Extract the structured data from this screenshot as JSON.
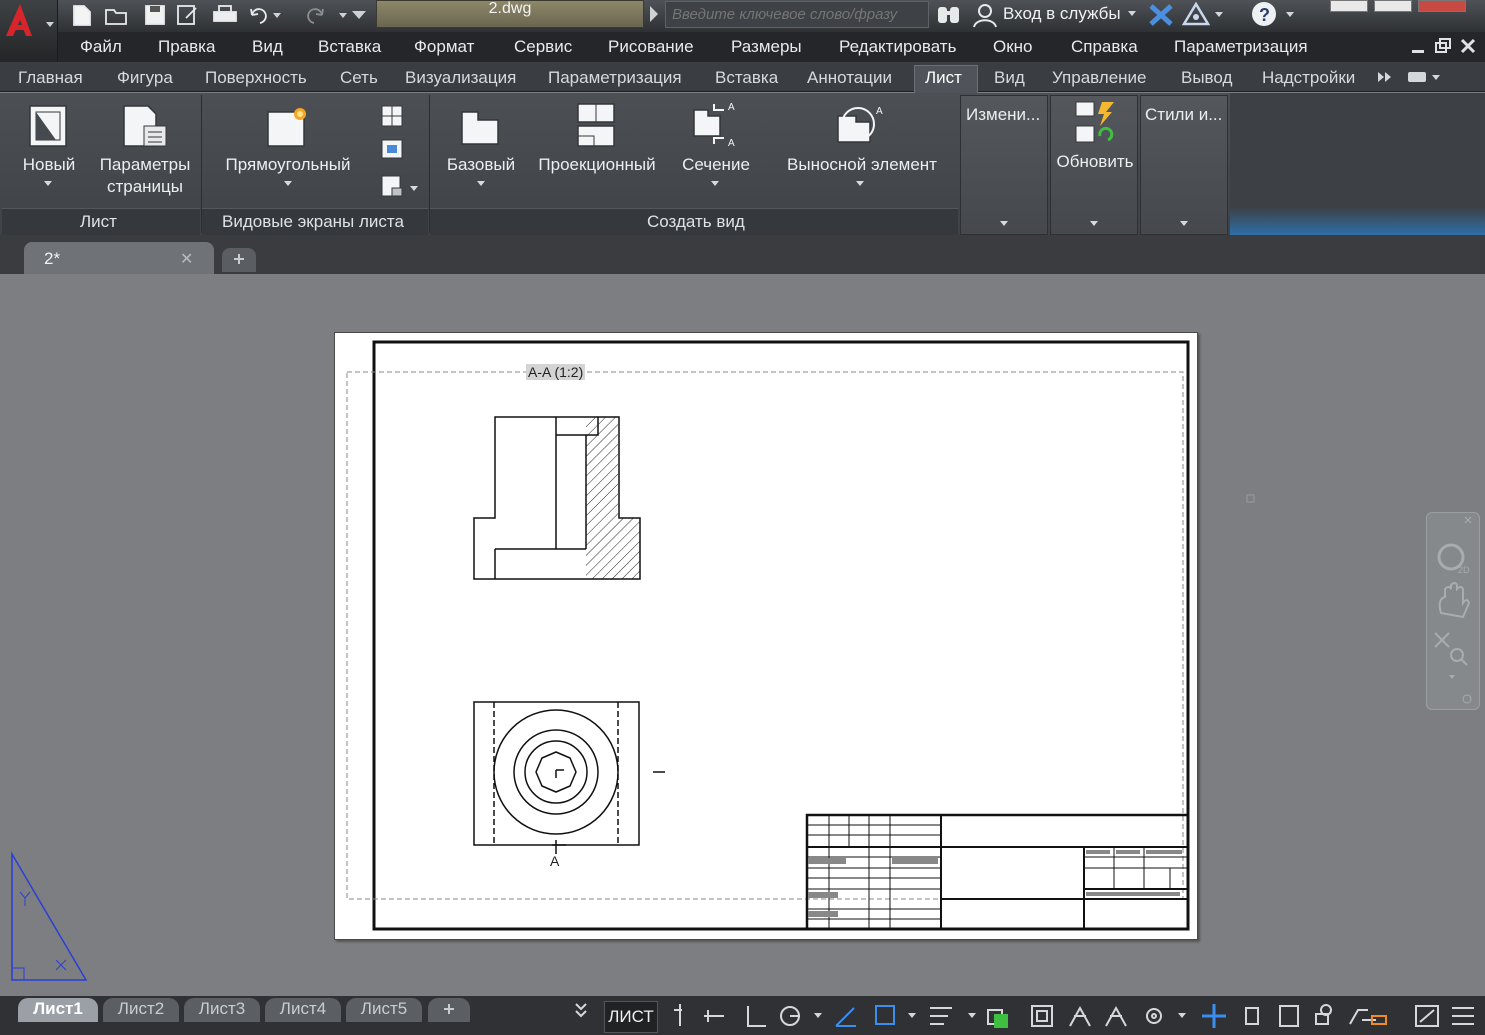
{
  "window": {
    "document_title": "2.dwg",
    "search_placeholder": "Введите ключевое слово/фразу",
    "signin_label": "Вход в службы"
  },
  "menu": [
    "Файл",
    "Правка",
    "Вид",
    "Вставка",
    "Формат",
    "Сервис",
    "Рисование",
    "Размеры",
    "Редактировать",
    "Окно",
    "Справка",
    "Параметризация"
  ],
  "ribbon_tabs": [
    "Главная",
    "Фигура",
    "Поверхность",
    "Сеть",
    "Визуализация",
    "Параметризация",
    "Вставка",
    "Аннотации",
    "Лист",
    "Вид",
    "Управление",
    "Вывод",
    "Надстройки"
  ],
  "active_ribbon_tab": "Лист",
  "ribbon": {
    "panel_sheet": {
      "title": "Лист",
      "new_label": "Новый",
      "page_setup_label": "Параметры страницы"
    },
    "panel_viewports": {
      "title": "Видовые экраны листа",
      "rectangular_label": "Прямоугольный"
    },
    "panel_create_view": {
      "title": "Создать вид",
      "base_label": "Базовый",
      "projected_label": "Проекционный",
      "section_label": "Сечение",
      "detail_label": "Выносной элемент"
    },
    "modify_label": "Измени...",
    "update_label": "Обновить",
    "styles_label": "Стили и..."
  },
  "file_tabs": [
    {
      "label": "2*",
      "active": true
    }
  ],
  "drawing": {
    "view_label": "A-A (1:2)",
    "section_marker": "A"
  },
  "layout_tabs": [
    "Лист1",
    "Лист2",
    "Лист3",
    "Лист4",
    "Лист5"
  ],
  "active_layout_tab": "Лист1",
  "status": {
    "space_label": "ЛИСТ"
  }
}
